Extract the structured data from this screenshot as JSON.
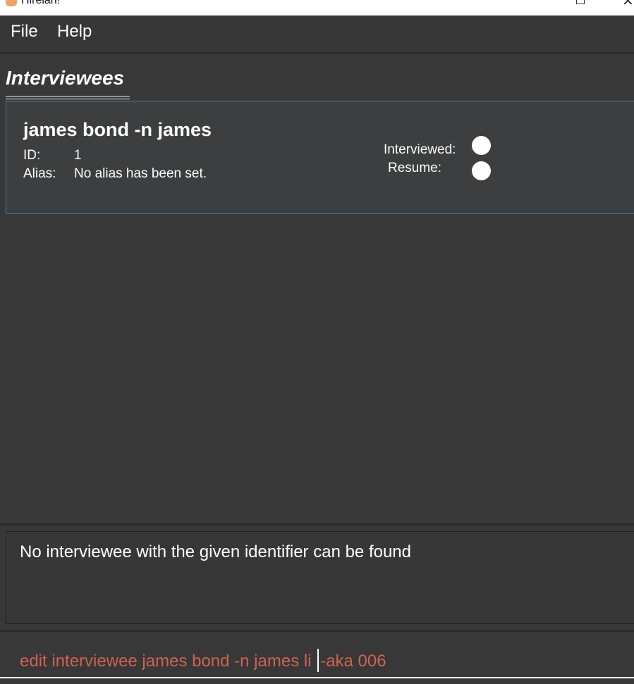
{
  "window": {
    "title": "Hirelah!",
    "maximize_glyph": "□",
    "close_glyph": "✕"
  },
  "menubar": {
    "items": [
      "File",
      "Help"
    ]
  },
  "section": {
    "title": "Interviewees"
  },
  "interviewee_card": {
    "name": "james bond -n james",
    "id_label": "ID:",
    "id_value": "1",
    "alias_label": "Alias:",
    "alias_value": "No alias has been set.",
    "interviewed_label": "Interviewed:",
    "resume_label": "Resume:"
  },
  "result": {
    "message": "No interviewee with the given identifier can be found"
  },
  "command": {
    "text_before_caret": "edit interviewee james bond -n james li ",
    "text_after_caret": "-aka 006"
  },
  "colors": {
    "background": "#383838",
    "card_border": "#3f7fa8",
    "command_text": "#d0624f"
  },
  "icons": [
    "app-icon",
    "maximize-icon",
    "close-icon",
    "interviewed-status-icon",
    "resume-status-icon"
  ]
}
